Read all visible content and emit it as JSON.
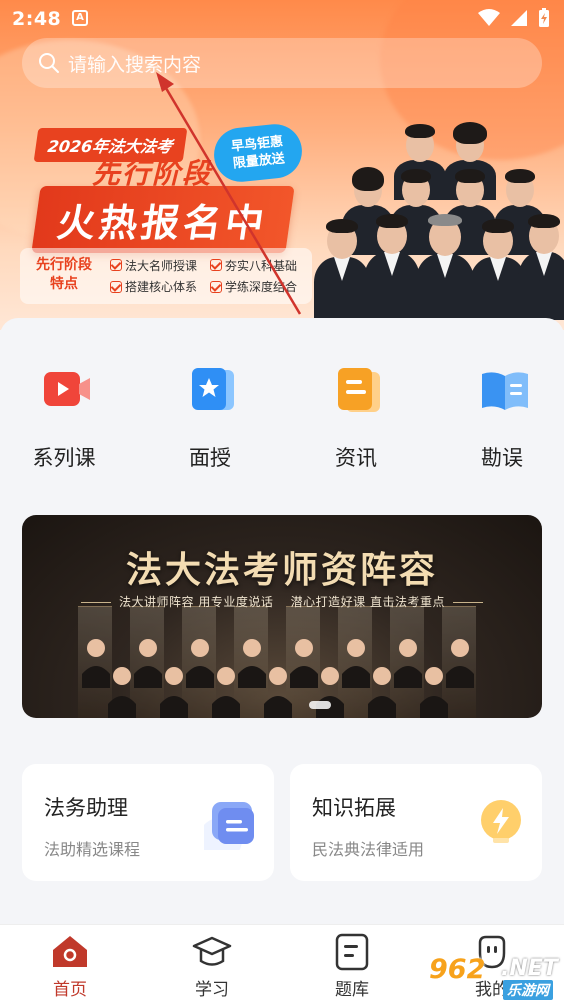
{
  "status_bar": {
    "time": "2:48",
    "app_badge": "A"
  },
  "search": {
    "placeholder": "请输入搜索内容"
  },
  "banner": {
    "tag": "2026年法大法考",
    "subtitle": "先行阶段",
    "headline": "火热报名中",
    "bubble_line1": "早鸟钜惠",
    "bubble_line2": "限量放送",
    "features_label_1": "先行阶段",
    "features_label_2": "特点",
    "features": [
      "法大名师授课",
      "夯实八科基础",
      "搭建核心体系",
      "学练深度结合"
    ]
  },
  "quick_links": [
    {
      "label": "系列课",
      "icon": "video-icon",
      "color": "#f0453a"
    },
    {
      "label": "面授",
      "icon": "star-card-icon",
      "color": "#2f8ff5"
    },
    {
      "label": "资讯",
      "icon": "document-icon",
      "color": "#f7a125"
    },
    {
      "label": "勘误",
      "icon": "book-icon",
      "color": "#3a93f2"
    }
  ],
  "lineup_banner": {
    "title": "法大法考师资阵容",
    "subtitle_left": "法大讲师阵容 用专业度说话",
    "subtitle_right": "潜心打造好课 直击法考重点"
  },
  "services": [
    {
      "title": "法务助理",
      "subtitle": "法助精选课程",
      "icon": "chat-icon"
    },
    {
      "title": "知识拓展",
      "subtitle": "民法典法律适用",
      "icon": "lightning-icon"
    }
  ],
  "tabs": [
    {
      "label": "首页",
      "icon": "home-icon",
      "active": true
    },
    {
      "label": "学习",
      "icon": "graduation-cap-icon",
      "active": false
    },
    {
      "label": "题库",
      "icon": "document-icon",
      "active": false
    },
    {
      "label": "我的",
      "icon": "profile-icon",
      "active": false
    }
  ],
  "watermark": {
    "number": "962",
    "suffix": ".NET",
    "site": "乐游网"
  },
  "colors": {
    "accent": "#c0392b",
    "banner_red": "#e8421f",
    "background": "#f4f5f8"
  }
}
